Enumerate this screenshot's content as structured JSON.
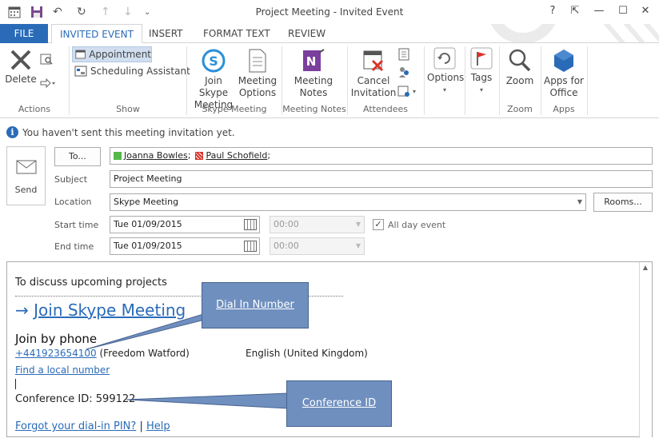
{
  "window": {
    "title": "Project Meeting - Invited Event",
    "controls": {
      "help": "?",
      "restore_ribbon": "⇱",
      "minimize": "—",
      "maximize": "☐",
      "close": "✕"
    }
  },
  "tabs": [
    {
      "label": "FILE",
      "active": false
    },
    {
      "label": "INVITED EVENT",
      "active": true
    },
    {
      "label": "INSERT",
      "active": false
    },
    {
      "label": "FORMAT TEXT",
      "active": false
    },
    {
      "label": "REVIEW",
      "active": false
    }
  ],
  "ribbon": {
    "actions": {
      "delete": "Delete",
      "group_label": "Actions"
    },
    "show": {
      "appointment": "Appointment",
      "scheduling": "Scheduling Assistant",
      "group_label": "Show"
    },
    "skype": {
      "join_line1": "Join Skype",
      "join_line2": "Meeting",
      "options_line1": "Meeting",
      "options_line2": "Options",
      "group_label": "Skype Meeting"
    },
    "notes": {
      "line1": "Meeting",
      "line2": "Notes",
      "group_label": "Meeting Notes"
    },
    "attendees": {
      "line1": "Cancel",
      "line2": "Invitation",
      "group_label": "Attendees"
    },
    "options": {
      "label": "Options"
    },
    "tags": {
      "label": "Tags"
    },
    "zoom": {
      "label": "Zoom",
      "group_label": "Zoom"
    },
    "apps": {
      "line1": "Apps for",
      "line2": "Office",
      "group_label": "Apps"
    }
  },
  "info_bar": {
    "icon": "info-icon",
    "text": "You haven't sent this meeting invitation yet."
  },
  "form": {
    "send": "Send",
    "to_button": "To...",
    "recipients": [
      {
        "name": "Joanna Bowles",
        "status_color": "#54b948",
        "separator": ";"
      },
      {
        "name": "Paul Schofield",
        "status_color": "#d9342b",
        "separator": ";"
      }
    ],
    "subject_label": "Subject",
    "subject_value": "Project Meeting",
    "location_label": "Location",
    "location_value": "Skype Meeting",
    "rooms_button": "Rooms...",
    "start_label": "Start time",
    "start_date": "Tue 01/09/2015",
    "start_time": "00:00",
    "all_day_label": "All day event",
    "all_day_checked": true,
    "end_label": "End time",
    "end_date": "Tue 01/09/2015",
    "end_time": "00:00"
  },
  "body": {
    "intro": "To discuss upcoming projects",
    "join_arrow": "→",
    "join_link": "Join Skype Meeting",
    "join_by_phone": "Join by phone",
    "phone_number": "+441923654100",
    "phone_location": "(Freedom Watford)",
    "phone_language": "English (United Kingdom)",
    "find_local": "Find a local number",
    "conference_id": "Conference ID: 599122",
    "forgot_pin": "Forgot your dial-in PIN?",
    "pipe": "|",
    "help": "Help"
  },
  "callouts": {
    "dial_in": "Dial In Number",
    "conference": "Conference ID"
  },
  "colors": {
    "accent": "#2a6bb8",
    "callout": "#6f8fbf"
  }
}
